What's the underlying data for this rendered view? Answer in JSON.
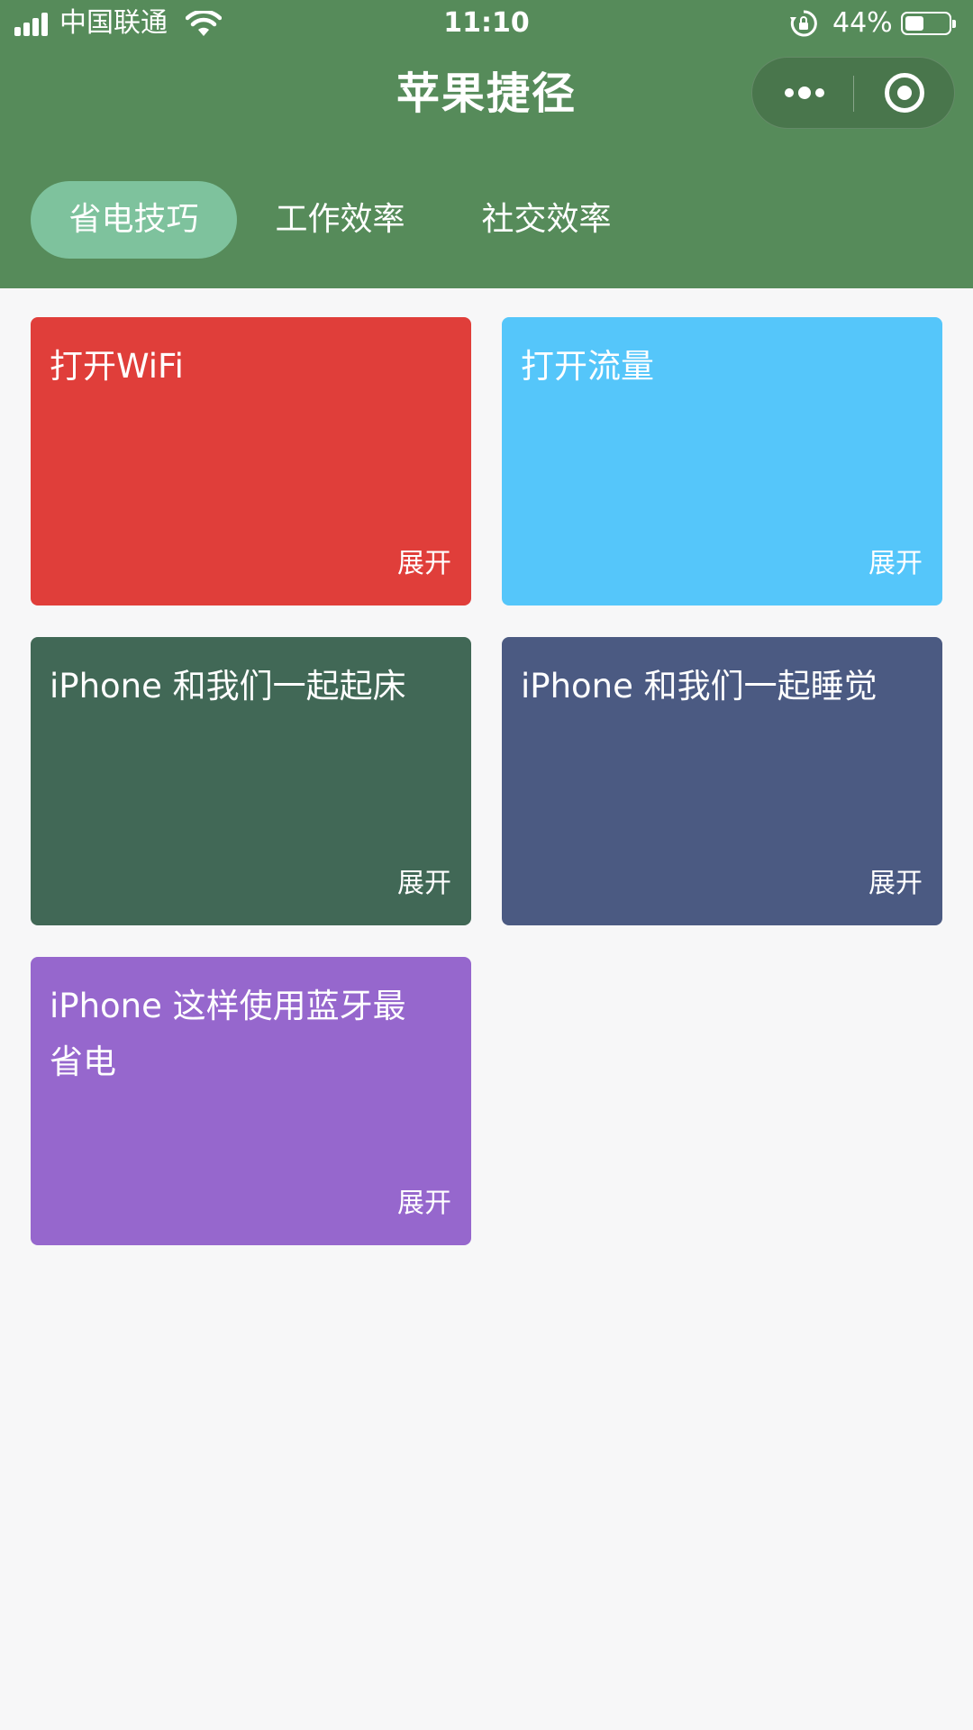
{
  "status_bar": {
    "carrier": "中国联通",
    "time": "11:10",
    "battery_percent": "44%",
    "battery_level": 0.44
  },
  "nav": {
    "title": "苹果捷径"
  },
  "tabs": [
    {
      "label": "省电技巧",
      "active": true
    },
    {
      "label": "工作效率",
      "active": false
    },
    {
      "label": "社交效率",
      "active": false
    }
  ],
  "cards": [
    {
      "title": "打开WiFi",
      "action": "展开",
      "color": "#e03e3a"
    },
    {
      "title": "打开流量",
      "action": "展开",
      "color": "#55c6fa"
    },
    {
      "title": "iPhone 和我们一起起床",
      "action": "展开",
      "color": "#416856"
    },
    {
      "title": "iPhone 和我们一起睡觉",
      "action": "展开",
      "color": "#4b5a82"
    },
    {
      "title": "iPhone 这样使用蓝牙最省电",
      "action": "展开",
      "color": "#9667cd"
    }
  ],
  "colors": {
    "header": "#568b5a",
    "active_tab": "#7ec29d",
    "page_background": "#f7f7f8"
  }
}
